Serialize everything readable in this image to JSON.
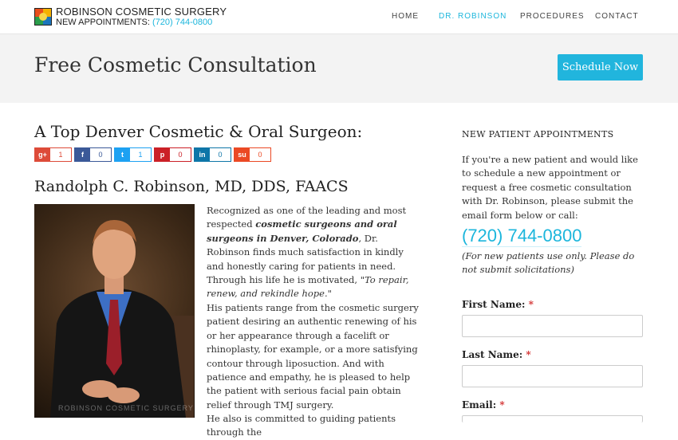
{
  "header": {
    "brand_name": "ROBINSON COSMETIC SURGERY",
    "appointments_label": "NEW APPOINTMENTS:",
    "appointments_phone": "(720) 744-0800",
    "nav": [
      "HOME",
      "DR. ROBINSON",
      "PROCEDURES",
      "CONTACT"
    ],
    "active_nav": "DR. ROBINSON"
  },
  "banner": {
    "title": "Free Cosmetic Consultation",
    "cta_label": "Schedule Now"
  },
  "main": {
    "heading": "A Top Denver Cosmetic & Oral Surgeon:",
    "share_buttons": [
      {
        "icon": "g+",
        "name": "google-plus-icon",
        "count": "1",
        "color": "#dd4b39"
      },
      {
        "icon": "f",
        "name": "facebook-icon",
        "count": "0",
        "color": "#3b5998"
      },
      {
        "icon": "t",
        "name": "twitter-icon",
        "count": "1",
        "color": "#1da1f2"
      },
      {
        "icon": "p",
        "name": "pinterest-icon",
        "count": "0",
        "color": "#cb2027"
      },
      {
        "icon": "in",
        "name": "linkedin-icon",
        "count": "0",
        "color": "#0e76a8"
      },
      {
        "icon": "su",
        "name": "stumbleupon-icon",
        "count": "0",
        "color": "#eb4924"
      }
    ],
    "doctor_name": "Randolph C. Robinson, MD, DDS, FAACS",
    "photo_watermark": "ROBINSON COSMETIC SURGERY",
    "para1_a": "Recognized as one of the leading and most respected ",
    "para1_b": "cosmetic surgeons and oral surgeons in Denver, Colorado",
    "para1_c": ", Dr. Robinson finds much satisfaction in kindly and honestly caring for patients in need. Through his life he is motivated, ",
    "para1_quote": "\"To repair, renew, and rekindle hope.\"",
    "para2": "His patients range from the cosmetic surgery patient desiring an authentic renewing of his or her appearance through a facelift or rhinoplasty, for example, or a more satisfying contour through liposuction. And with patience and empathy, he is pleased to help the patient with serious facial pain obtain relief through TMJ surgery.",
    "para3": "He also is committed to guiding patients through the"
  },
  "sidebar": {
    "title": "NEW PATIENT APPOINTMENTS",
    "text": "If you're a new patient and would like to schedule a new appointment or request a free cosmetic consultation with Dr. Robinson, please submit the email form below or call:",
    "phone": "(720) 744-0800",
    "note": "(For new patients use only. Please do not submit solicitations)",
    "fields": [
      {
        "label": "First Name:",
        "required": "*"
      },
      {
        "label": "Last Name:",
        "required": "*"
      },
      {
        "label": "Email:",
        "required": "*"
      }
    ]
  },
  "colors": {
    "accent": "#1cb6dc",
    "banner_bg": "#f3f3f3"
  }
}
